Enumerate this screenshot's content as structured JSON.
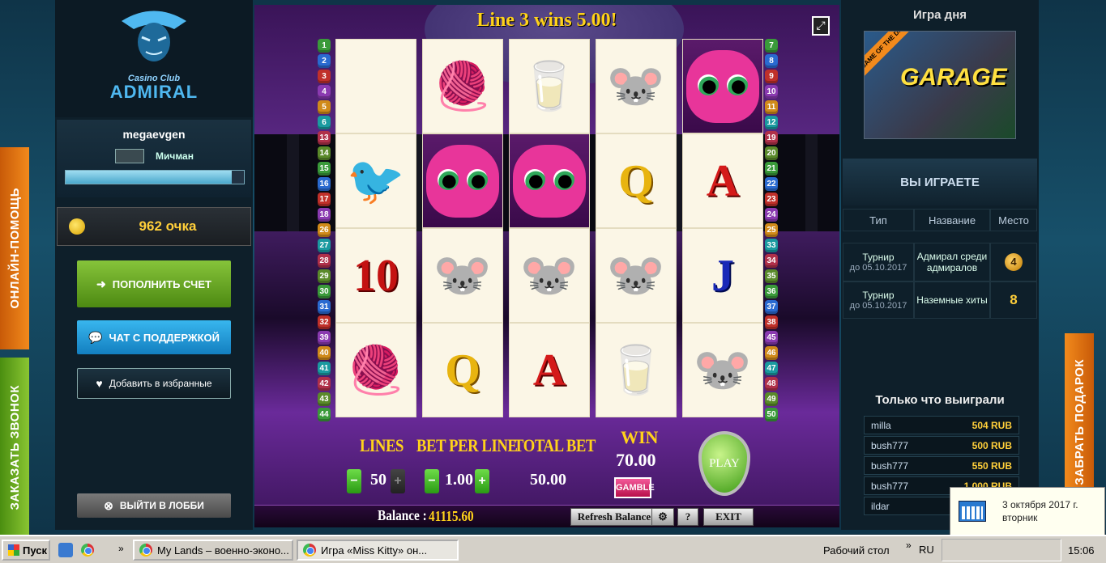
{
  "side_tabs": {
    "help": "ОНЛАЙН-ПОМОЩЬ",
    "call": "ЗАКАЗАТЬ ЗВОНОК",
    "gift": "ЗАБРАТЬ ПОДАРОК"
  },
  "logo": {
    "small": "Casino Club",
    "big": "ADMIRAL"
  },
  "user": {
    "name": "megaevgen",
    "rank": "Мичман",
    "progress": 0.93
  },
  "points": "962 очка",
  "buttons": {
    "deposit": "ПОПОЛНИТЬ СЧЕТ",
    "chat": "ЧАТ С ПОДДЕРЖКОЙ",
    "favorite": "Добавить в избранные",
    "lobby": "ВЫЙТИ В ЛОББИ"
  },
  "game": {
    "win_banner": "Line 3 wins 5.00!",
    "left_lines": [
      "1",
      "2",
      "3",
      "4",
      "5",
      "6",
      "13",
      "14",
      "15",
      "16",
      "17",
      "18",
      "26",
      "27",
      "28",
      "29",
      "30",
      "31",
      "32",
      "39",
      "40",
      "41",
      "42",
      "43",
      "44"
    ],
    "right_lines": [
      "7",
      "8",
      "9",
      "10",
      "11",
      "12",
      "19",
      "20",
      "21",
      "22",
      "23",
      "24",
      "25",
      "33",
      "34",
      "35",
      "36",
      "37",
      "38",
      "45",
      "46",
      "47",
      "48",
      "49",
      "50"
    ],
    "reels": [
      [
        "",
        "bird",
        "10",
        "yarn"
      ],
      [
        "yarn",
        "cat",
        "mouse",
        "Q"
      ],
      [
        "milk",
        "cat",
        "mouse",
        "A"
      ],
      [
        "mouse",
        "Q",
        "mouse",
        "milk"
      ],
      [
        "cat",
        "A",
        "J",
        "mouse"
      ]
    ],
    "lines_label": "LINES",
    "lines_value": "50",
    "bet_label": "BET PER LINE",
    "bet_value": "1.00",
    "total_label": "TOTAL BET",
    "total_value": "50.00",
    "win_label": "WIN",
    "win_value": "70.00",
    "gamble": "GAMBLE",
    "play": "PLAY",
    "balance_label": "Balance :",
    "balance_value": "41115.60",
    "refresh": "Refresh Balance",
    "help": "?",
    "exit": "EXIT",
    "settings": "⚙",
    "minus": "−",
    "plus": "+"
  },
  "right": {
    "game_of_day_title": "Игра дня",
    "gotd_ribbon": "GAME OF THE DAY",
    "gotd_name": "GARAGE",
    "playing_title": "ВЫ ИГРАЕТЕ",
    "table_headers": [
      "Тип",
      "Название",
      "Место"
    ],
    "tournaments": [
      {
        "type": "Турнир",
        "until": "до 05.10.2017",
        "name": "Адмирал среди адмиралов",
        "place": "4"
      },
      {
        "type": "Турнир",
        "until": "до 05.10.2017",
        "name": "Наземные хиты",
        "place": "8"
      }
    ],
    "winners_title": "Только что выиграли",
    "winners": [
      {
        "name": "milla",
        "amount": "504 RUB"
      },
      {
        "name": "bush777",
        "amount": "500 RUB"
      },
      {
        "name": "bush777",
        "amount": "550 RUB"
      },
      {
        "name": "bush777",
        "amount": "1 000 RUB"
      },
      {
        "name": "ildar",
        "amount": ""
      }
    ]
  },
  "date_popup": {
    "line1": "3 октября 2017 г.",
    "line2": "вторник"
  },
  "taskbar": {
    "start": "Пуск",
    "tasks": [
      "My Lands – военно-эконо...",
      "Игра «Miss Kitty» он..."
    ],
    "desktop": "Рабочий стол",
    "lang": "RU",
    "clock": "15:06"
  }
}
